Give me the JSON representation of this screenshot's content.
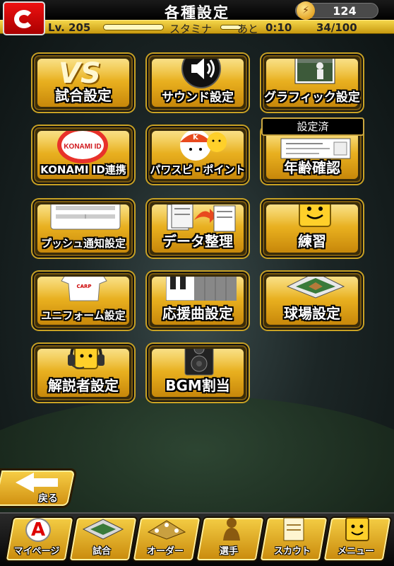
{
  "header": {
    "title": "各種設定",
    "coins": "124",
    "level": "Lv. 205",
    "stamina_label": "スタミナ",
    "ato_label": "あと",
    "timer": "0:10",
    "stamina_count": "34/100",
    "stamina_fraction": 1.0
  },
  "settings": {
    "match": "試合設定",
    "sound": "サウンド設定",
    "graphic": "グラフィック設定",
    "konami": "KONAMI ID連携",
    "konami_logo_text": "KONAMI ID",
    "pawaspi": "パワスピ・ポイント",
    "age": "年齢確認",
    "age_badge": "設定済",
    "push": "プッシュ通知設定",
    "data": "データ整理",
    "practice": "練習",
    "uniform": "ユニフォーム設定",
    "cheer": "応援曲設定",
    "stadium": "球場設定",
    "commentator": "解説者設定",
    "bgm": "BGM割当",
    "vs_text": "VS"
  },
  "back": {
    "label": "戻る"
  },
  "nav": {
    "mypage": "マイページ",
    "match": "試合",
    "order": "オーダー",
    "player": "選手",
    "scout": "スカウト",
    "menu": "メニュー"
  }
}
